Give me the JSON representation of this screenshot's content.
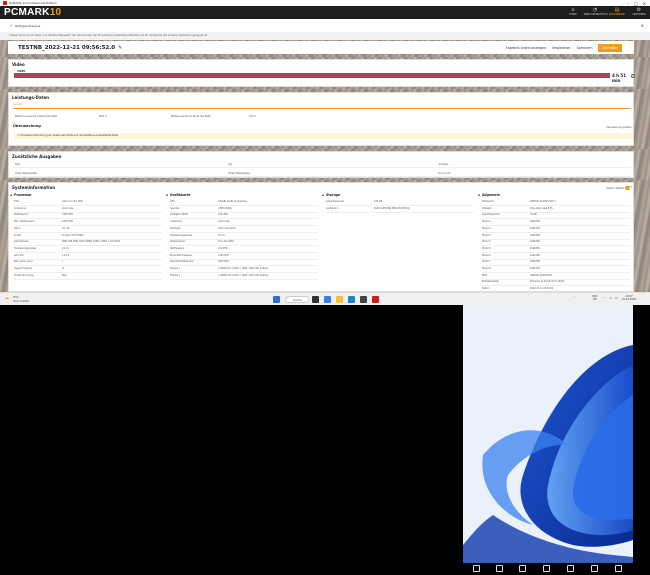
{
  "window_title": "PCMARK 10 Professional Edition",
  "app": {
    "logo_a": "PCMARK",
    "logo_b": "10"
  },
  "nav": [
    {
      "label": "HOME",
      "glyph": "⌂"
    },
    {
      "label": "BENCHMARKTESTS",
      "glyph": "◔"
    },
    {
      "label": "ERGEBNISSE",
      "glyph": "▤"
    },
    {
      "label": "OPTIONEN",
      "glyph": "⚙"
    }
  ],
  "result_page": {
    "back_title": "Gültiges Ereignis",
    "note": "Dieser Score ist ein fairer und direkter Messwert, der die Grenzen der PC-Leistung zuverlässig abbildet und für Vergleiche mit anderen Systemen geeignet ist.",
    "result_name": "TESTNB_2022-12-21 09:56:52.0",
    "actions": {
      "online": "Ergebnis online anzeigen",
      "compare": "Vergleichen",
      "save": "Speichern",
      "export": "Schließen"
    }
  },
  "video": {
    "heading": "Video",
    "label": "VIDEO",
    "result": "4 h 51 min",
    "progress": 1.0
  },
  "performance": {
    "heading": "Leistungs-Daten",
    "sublabel": "Laufzeit",
    "rows": [
      {
        "k": "Batterie-Level am Anfang des Tests",
        "v": "98,5 %",
        "k2": "Batterie-Level am Ende des Tests",
        "v2": "3,9 %"
      }
    ],
    "monitoring_heading": "Überwachung",
    "monitoring_link": "Überwachung Details",
    "warning": "⚠ Hardware-Monitoring ist deaktiviert während des Batterie-Laufzeittest-Tests"
  },
  "extra": {
    "heading": "Zusätzliche Ausgaben",
    "cols": [
      "Test",
      "Typ",
      "Ausgabe"
    ],
    "row": [
      "Video Wiedergabe",
      "Video Wiedergabe",
      "Score 4,71"
    ]
  },
  "sysinfo": {
    "heading": "Systeminformation",
    "toggle_label": "System-Details",
    "groups": [
      {
        "title": "Prozessor",
        "rows": [
          [
            "Titel",
            "Intel Core i5-1235U"
          ],
          [
            "Codename",
            "Alder Lake"
          ],
          [
            "Taktfrequenz",
            "1300 MHz"
          ],
          [
            "Max. Taktfrequenz",
            "4400 MHz"
          ],
          [
            "Kerne",
            "10 (12)"
          ],
          [
            "Sockel",
            "Socket 1744 FCBGA"
          ],
          [
            "Instruktionen",
            "MMX SSE SSE2 SSE3 SSSE3 SSE4.1 SSE4.2 AVX AVX2"
          ],
          [
            "Herstellungsprozess",
            "10 nm"
          ],
          [
            "Kern-VID",
            "1,14 V"
          ],
          [
            "Max Cache Level",
            "3"
          ],
          [
            "Hyper-Threading",
            "ja"
          ],
          [
            "Virtual Technology",
            "Nein"
          ]
        ]
      },
      {
        "title": "Grafikkarte",
        "rows": [
          [
            "GPU",
            "Intel(R) Iris(R) Xe Graphics"
          ],
          [
            "Speicher",
            "0 MB (DDR4)"
          ],
          [
            "Verfügbar VRAM",
            "1024 MB"
          ],
          [
            "Codename",
            "Alder Lake"
          ],
          [
            "Hersteller",
            "Intel Corporation"
          ],
          [
            "Herstellungsprozess",
            "10 nm"
          ],
          [
            "Treiberversion",
            "31.0.101.3616"
          ],
          [
            "Taktfrequenz",
            "100 MHz"
          ],
          [
            "Boost-Takt-Frequenz",
            "1300 MHz"
          ],
          [
            "Speichertaktfrequenz",
            "2400 MHz"
          ],
          [
            "Display 1",
            "\\\\.\\DISPLAY1 (1920 × 1080, 100% DPI scaling)"
          ],
          [
            "Display 2",
            "\\\\.\\DISPLAY2 (1920 × 1080, 100% DPI scaling)"
          ]
        ]
      },
      {
        "title": "Storage",
        "rows": [
          [
            "Gesamtspeicher",
            "476 GB"
          ],
          [
            "Laufwerk C:",
            "SSD (SAMSUNG MZVL2512HCJQ)"
          ]
        ]
      },
      {
        "title": "Allgemein",
        "rows": [
          [
            "Mainboard",
            "LENOVO 21AH00 SDK T"
          ],
          [
            "Chipsatz",
            "Intel Alder Lake-P ES"
          ],
          [
            "Gesamtspeicher",
            "16 GB"
          ],
          [
            "Modul 1",
            "4096 MB"
          ],
          [
            "Modul 2",
            "4096 MB"
          ],
          [
            "Modul 3",
            "4096 MB"
          ],
          [
            "Modul 4",
            "4096 MB"
          ],
          [
            "Modul 5",
            "4096 MB"
          ],
          [
            "Modul 6",
            "4096 MB"
          ],
          [
            "Modul 7",
            "4096 MB"
          ],
          [
            "Modul 8",
            "4096 MB"
          ],
          [
            "BIOS",
            "LENOVO N3AET66W"
          ],
          [
            "Betriebssystem",
            "Windows 11 64-bit (10.0.22621)"
          ],
          [
            "Datum",
            "2022-12-21 09:56:52"
          ]
        ]
      }
    ]
  },
  "taskbar": {
    "weather_temp": "4°C",
    "weather_text": "Stark bewölkt",
    "search": "Suche",
    "lang": "DEU",
    "lang2": "DE",
    "time": "10:07",
    "date": "21.12.2022"
  },
  "colors": {
    "accent": "#f29a1f",
    "video_bar": "#a04a5c",
    "header": "#1e1e1e"
  }
}
